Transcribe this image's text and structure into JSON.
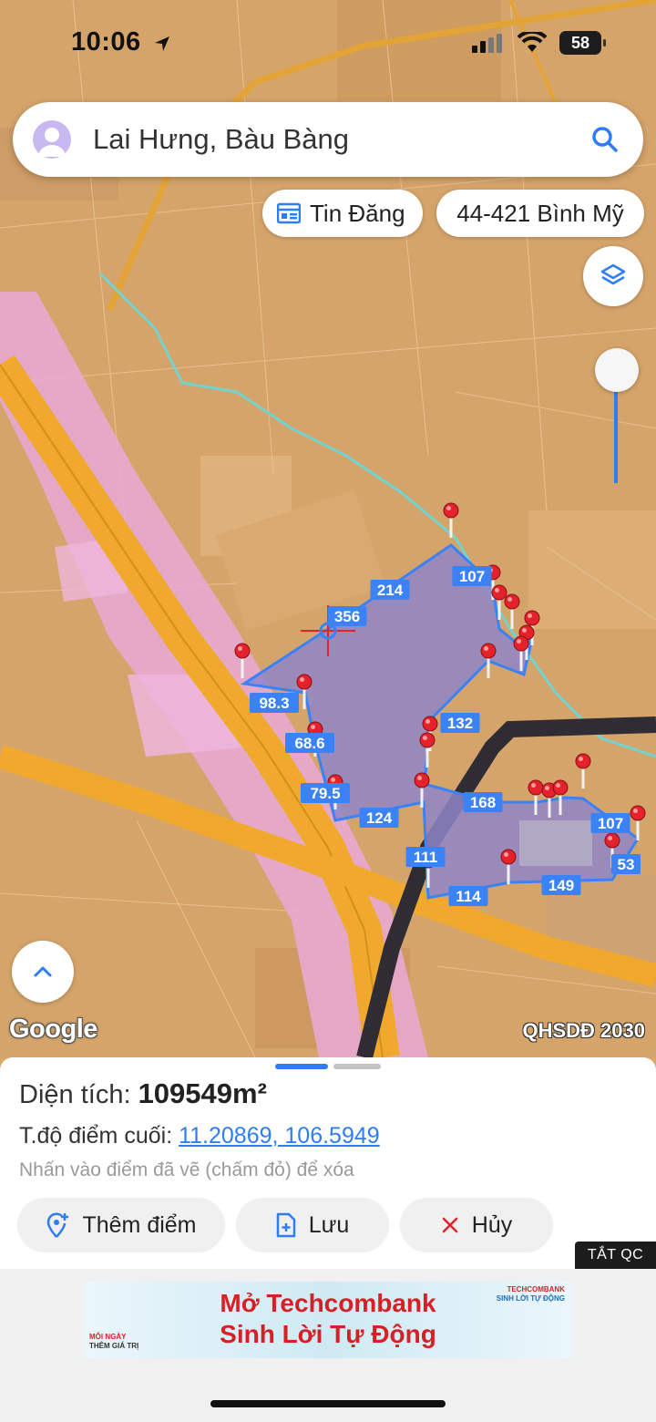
{
  "status_bar": {
    "time": "10:06",
    "battery": "58"
  },
  "search": {
    "text": "Lai Hưng, Bàu Bàng"
  },
  "chips": {
    "news": "Tin Đăng",
    "plan_code": "44-421 Bình Mỹ"
  },
  "map": {
    "edge_labels": [
      "214",
      "356",
      "107",
      "98.3",
      "68.6",
      "132",
      "79.5",
      "124",
      "168",
      "107",
      "111",
      "53",
      "114",
      "149"
    ],
    "attribution": "Google",
    "plan_layer": "QHSDĐ 2030"
  },
  "sheet": {
    "area_label": "Diện tích: ",
    "area_value": "109549m²",
    "coord_label": "T.độ điểm cuối: ",
    "coord_value": "11.20869, 106.5949",
    "hint": "Nhấn vào điểm đã vẽ (chấm đỏ) để xóa",
    "actions": {
      "add": "Thêm điểm",
      "save": "Lưu",
      "cancel": "Hủy"
    }
  },
  "ad": {
    "close_label": "TẮT QC",
    "line1": "Mở Techcombank",
    "line2": "Sinh Lời Tự Động",
    "tag_line1": "MỖI NGÀY",
    "tag_line2": "THÊM GIÁ TRỊ",
    "brand_line1": "TECHCOMBANK",
    "brand_line2": "SINH LỜI TỰ ĐỘNG"
  },
  "colors": {
    "accent": "#2f7df6",
    "pin": "#e3222b",
    "polygon": "#8f86c8",
    "ad_red": "#d91f26"
  }
}
